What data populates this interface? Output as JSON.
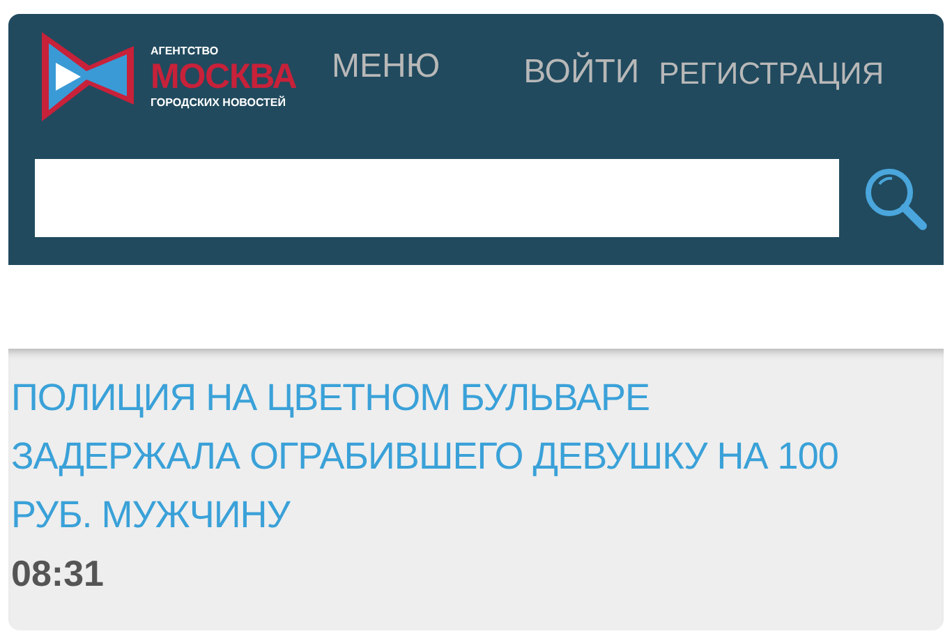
{
  "logo": {
    "top": "АГЕНТСТВО",
    "main": "МОСКВА",
    "bottom": "ГОРОДСКИХ НОВОСТЕЙ"
  },
  "nav": [
    "МЕНЮ",
    "ВОЙТИ",
    "РЕГИСТРАЦИЯ"
  ],
  "news": {
    "headline": "ПОЛИЦИЯ НА ЦВЕТНОМ БУЛЬВАРЕ ЗАДЕРЖАЛА ОГРАБИВШЕГО ДЕВУШКУ НА 100 РУБ. МУЖЧИНУ",
    "time": "08:31"
  }
}
